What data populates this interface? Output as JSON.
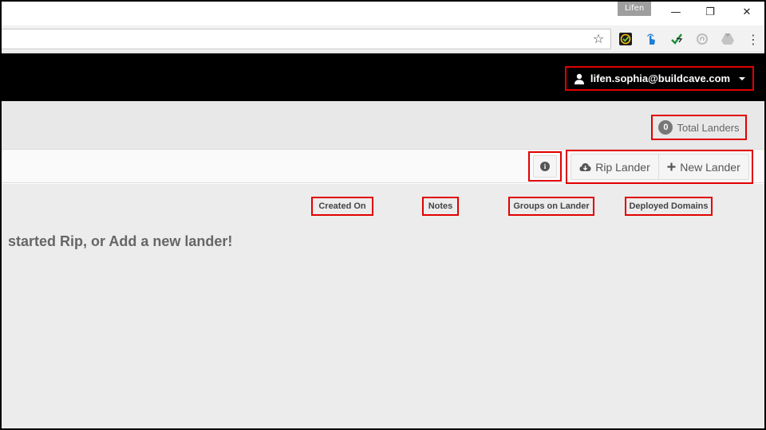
{
  "window": {
    "profile_name": "Lifen",
    "minimize_glyph": "—",
    "maximize_glyph": "❐",
    "close_glyph": "✕"
  },
  "toolbar": {
    "bookmark_icon": "star-icon",
    "extensions": [
      "checkmark-shield-icon",
      "hand-touch-icon",
      "arrow-leaf-icon",
      "circle-lock-icon",
      "drive-triangle-icon"
    ],
    "menu_glyph": "⋮"
  },
  "navbar": {
    "user_email": "lifen.sophia@buildcave.com",
    "user_icon": "user-icon"
  },
  "stats": {
    "total_count": "0",
    "total_label": "Total Landers"
  },
  "actions": {
    "info_icon": "info-icon",
    "rip_label": "Rip Lander",
    "new_label": "New Lander"
  },
  "table": {
    "columns": [
      "Created On",
      "Notes",
      "Groups on Lander",
      "Deployed Domains"
    ],
    "empty_message": "started Rip, or Add a new lander!"
  },
  "colors": {
    "highlight": "#e10000",
    "navbar": "#000000"
  }
}
